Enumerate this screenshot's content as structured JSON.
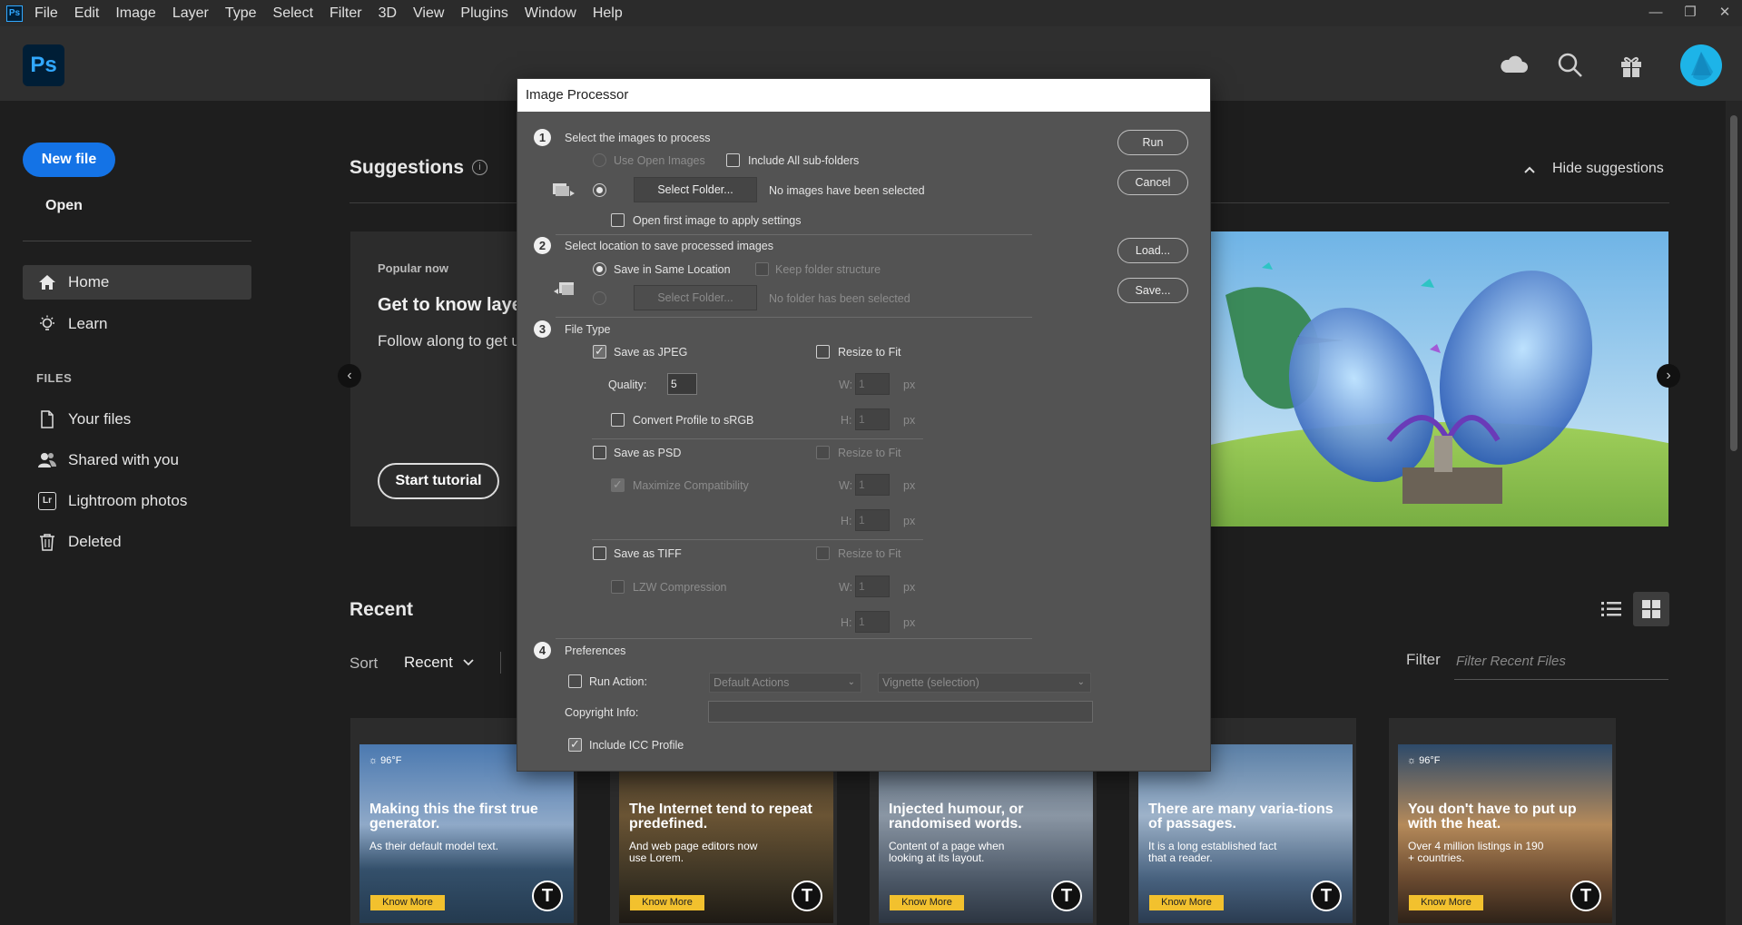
{
  "menubar": {
    "logo": "Ps",
    "items": [
      "File",
      "Edit",
      "Image",
      "Layer",
      "Type",
      "Select",
      "Filter",
      "3D",
      "View",
      "Plugins",
      "Window",
      "Help"
    ],
    "window_controls": [
      "—",
      "❐",
      "✕"
    ]
  },
  "header": {
    "logo": "Ps"
  },
  "sidebar": {
    "new_file": "New file",
    "open": "Open",
    "nav": [
      {
        "label": "Home",
        "icon": "home-icon"
      },
      {
        "label": "Learn",
        "icon": "lightbulb-icon"
      }
    ],
    "files_heading": "FILES",
    "files": [
      {
        "label": "Your files",
        "icon": "file-icon"
      },
      {
        "label": "Shared with you",
        "icon": "users-icon"
      },
      {
        "label": "Lightroom photos",
        "icon": "lightroom-icon",
        "badge": "Lr"
      },
      {
        "label": "Deleted",
        "icon": "trash-icon"
      }
    ]
  },
  "suggestions": {
    "title": "Suggestions",
    "hide": "Hide suggestions",
    "popular": "Popular now",
    "card_title": "Get to know layers",
    "card_text": "Follow along to get up to speed",
    "start_tutorial": "Start tutorial"
  },
  "recent": {
    "title": "Recent",
    "sort_label": "Sort",
    "sort_value": "Recent",
    "filter_label": "Filter",
    "filter_placeholder": "Filter Recent Files",
    "thumbs": [
      {
        "weather": "☼ 96°F",
        "headline": "Making this the first true generator.",
        "sub": "As their default model text.",
        "button": "Know More"
      },
      {
        "weather": "",
        "headline": "The Internet tend to repeat predefined.",
        "sub": "And web page editors now use Lorem.",
        "button": "Know More"
      },
      {
        "weather": "",
        "headline": "Injected humour, or randomised words.",
        "sub": "Content of a page when looking at its layout.",
        "button": "Know More"
      },
      {
        "weather": "",
        "headline": "There are many varia-tions of passages.",
        "sub": "It is a long established fact that a reader.",
        "button": "Know More"
      },
      {
        "weather": "☼ 96°F",
        "headline": "You don't have to put up with the heat.",
        "sub": "Over 4 million listings in 190 + countries.",
        "button": "Know More"
      }
    ],
    "thumb_logo": "T"
  },
  "dialog": {
    "title": "Image Processor",
    "step1": {
      "num": "1",
      "title": "Select the images to process",
      "use_open": "Use Open Images",
      "include_sub": "Include All sub-folders",
      "select_folder": "Select Folder...",
      "status": "No images have been selected",
      "open_first": "Open first image to apply settings"
    },
    "step2": {
      "num": "2",
      "title": "Select location to save processed images",
      "same_location": "Save in Same Location",
      "keep_structure": "Keep folder structure",
      "select_folder": "Select Folder...",
      "status": "No folder has been selected"
    },
    "step3": {
      "num": "3",
      "title": "File Type",
      "jpeg": "Save as JPEG",
      "quality_label": "Quality:",
      "quality": "5",
      "convert": "Convert Profile to sRGB",
      "psd": "Save as PSD",
      "maximize": "Maximize Compatibility",
      "tiff": "Save as TIFF",
      "lzw": "LZW Compression",
      "resize": "Resize to Fit",
      "w_label": "W:",
      "h_label": "H:",
      "unit": "px",
      "dim_value": "1"
    },
    "step4": {
      "num": "4",
      "title": "Preferences",
      "run_action": "Run Action:",
      "action_set": "Default Actions",
      "action": "Vignette (selection)",
      "copyright": "Copyright Info:",
      "copyright_value": "",
      "icc": "Include ICC Profile"
    },
    "buttons": {
      "run": "Run",
      "cancel": "Cancel",
      "load": "Load...",
      "save": "Save..."
    }
  }
}
